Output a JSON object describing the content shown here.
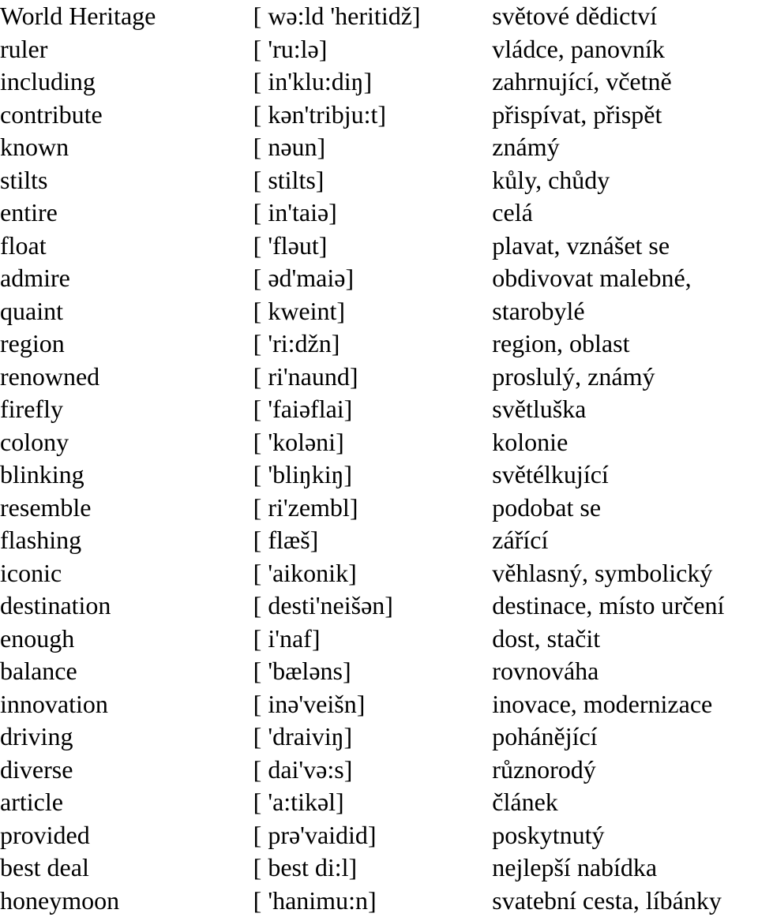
{
  "document": {
    "type": "vocabulary-list",
    "page_background": "#ffffff",
    "text_color": "#000000",
    "columns": [
      "word",
      "pronunciation",
      "translation"
    ],
    "rows": [
      {
        "word": "World Heritage",
        "pronunciation": "[ wə:ld 'heritidž]",
        "translation": "světové dědictví"
      },
      {
        "word": "ruler",
        "pronunciation": "[ 'ru:lə]",
        "translation": "vládce, panovník"
      },
      {
        "word": "including",
        "pronunciation": "[ in'klu:diŋ]",
        "translation": "zahrnující, včetně"
      },
      {
        "word": "contribute",
        "pronunciation": "[ kən'tribju:t]",
        "translation": "přispívat, přispět"
      },
      {
        "word": "known",
        "pronunciation": "[ nəun]",
        "translation": "známý"
      },
      {
        "word": "stilts",
        "pronunciation": "[ stilts]",
        "translation": "kůly, chůdy"
      },
      {
        "word": "entire",
        "pronunciation": "[ in'taiə]",
        "translation": "celá"
      },
      {
        "word": "float",
        "pronunciation": "[ 'fləut]",
        "translation": "plavat, vznášet se"
      },
      {
        "word": "admire",
        "pronunciation": "[ əd'maiə]",
        "translation": "obdivovat malebné,"
      },
      {
        "word": "quaint",
        "pronunciation": "[ kweint]",
        "translation": "starobylé"
      },
      {
        "word": "region",
        "pronunciation": "[ 'ri:džn]",
        "translation": "region, oblast"
      },
      {
        "word": "renowned",
        "pronunciation": "[ ri'naund]",
        "translation": "proslulý, známý"
      },
      {
        "word": "firefly",
        "pronunciation": "[ 'faiəflai]",
        "translation": "světluška"
      },
      {
        "word": "colony",
        "pronunciation": "[ 'koləni]",
        "translation": "kolonie"
      },
      {
        "word": "blinking",
        "pronunciation": "[ 'bliŋkiŋ]",
        "translation": "světélkující"
      },
      {
        "word": "resemble",
        "pronunciation": "[ ri'zembl]",
        "translation": "podobat se"
      },
      {
        "word": "flashing",
        "pronunciation": "[ flæš]",
        "translation": "zářící"
      },
      {
        "word": "iconic",
        "pronunciation": "[ 'aikonik]",
        "translation": "věhlasný, symbolický"
      },
      {
        "word": "destination",
        "pronunciation": "[ desti'neišən]",
        "translation": "destinace, místo určení"
      },
      {
        "word": "enough",
        "pronunciation": "[ i'naf]",
        "translation": "dost, stačit"
      },
      {
        "word": "balance",
        "pronunciation": "[ 'bæləns]",
        "translation": "rovnováha"
      },
      {
        "word": "innovation",
        "pronunciation": "[ inə'veišn]",
        "translation": "inovace, modernizace"
      },
      {
        "word": "driving",
        "pronunciation": "[ 'draiviŋ]",
        "translation": "pohánějící"
      },
      {
        "word": "diverse",
        "pronunciation": "[ dai'və:s]",
        "translation": "různorodý"
      },
      {
        "word": "article",
        "pronunciation": "[ 'a:tikəl]",
        "translation": "článek"
      },
      {
        "word": "provided",
        "pronunciation": "[ prə'vaidid]",
        "translation": "poskytnutý"
      },
      {
        "word": "best deal",
        "pronunciation": "[ best di:l]",
        "translation": "nejlepší nabídka"
      },
      {
        "word": "honeymoon",
        "pronunciation": "[ 'hanimu:n]",
        "translation": "svatební cesta, líbánky"
      }
    ]
  }
}
